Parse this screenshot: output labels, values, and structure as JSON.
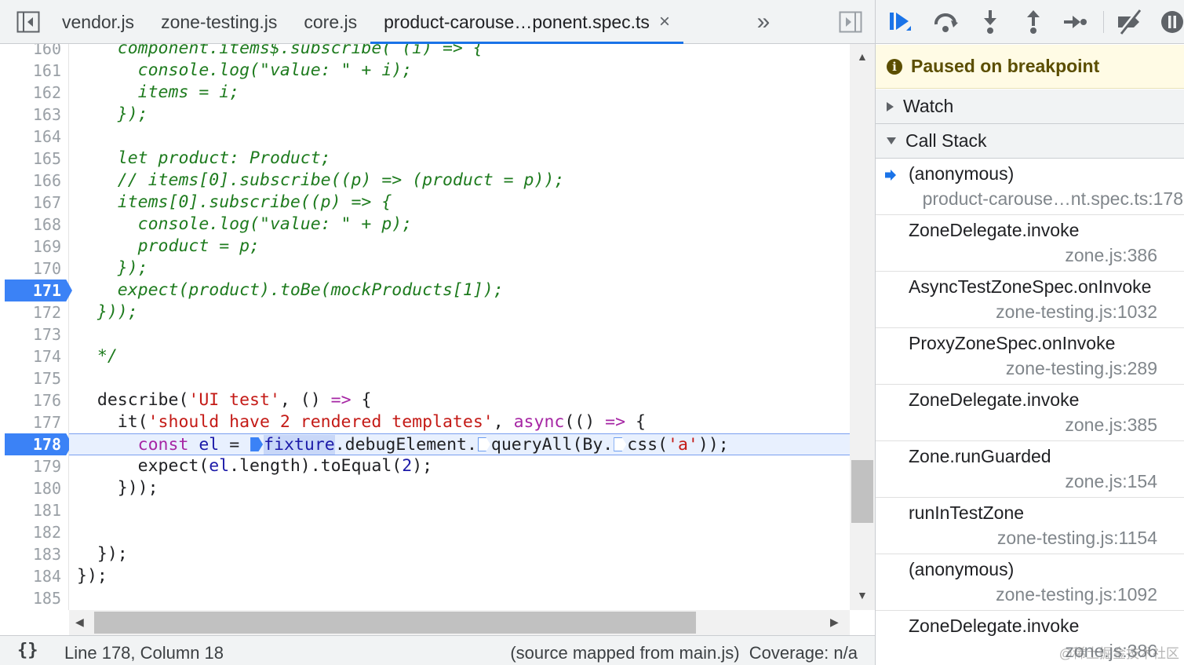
{
  "editor": {
    "tabs": [
      {
        "label": "vendor.js",
        "active": false
      },
      {
        "label": "zone-testing.js",
        "active": false
      },
      {
        "label": "core.js",
        "active": false
      },
      {
        "label": "product-carouse…ponent.spec.ts",
        "active": true
      }
    ],
    "tab_close_glyph": "×",
    "more_tabs_glyph": "»",
    "lines": [
      {
        "n": "160",
        "tokens": [
          {
            "t": "    component.items$.subscribe( (i) => {",
            "c": "cm"
          }
        ]
      },
      {
        "n": "161",
        "tokens": [
          {
            "t": "      console.log(\"value: \" + i);",
            "c": "cm"
          }
        ]
      },
      {
        "n": "162",
        "tokens": [
          {
            "t": "      items = i;",
            "c": "cm"
          }
        ]
      },
      {
        "n": "163",
        "tokens": [
          {
            "t": "    });",
            "c": "cm"
          }
        ]
      },
      {
        "n": "164",
        "tokens": []
      },
      {
        "n": "165",
        "tokens": [
          {
            "t": "    let product: Product;",
            "c": "cm"
          }
        ]
      },
      {
        "n": "166",
        "tokens": [
          {
            "t": "    // items[0].subscribe((p) => (product = p));",
            "c": "cm"
          }
        ]
      },
      {
        "n": "167",
        "tokens": [
          {
            "t": "    items[0].subscribe((p) => {",
            "c": "cm"
          }
        ]
      },
      {
        "n": "168",
        "tokens": [
          {
            "t": "      console.log(\"value: \" + p);",
            "c": "cm"
          }
        ]
      },
      {
        "n": "169",
        "tokens": [
          {
            "t": "      product = p;",
            "c": "cm"
          }
        ]
      },
      {
        "n": "170",
        "tokens": [
          {
            "t": "    });",
            "c": "cm"
          }
        ]
      },
      {
        "n": "171",
        "bp": true,
        "tokens": [
          {
            "t": "    expect(product).toBe(mockProducts[1]);",
            "c": "cm"
          }
        ]
      },
      {
        "n": "172",
        "tokens": [
          {
            "t": "  }));",
            "c": "cm"
          }
        ]
      },
      {
        "n": "173",
        "tokens": []
      },
      {
        "n": "174",
        "tokens": [
          {
            "t": "  */",
            "c": "cm"
          }
        ]
      },
      {
        "n": "175",
        "tokens": []
      },
      {
        "n": "176",
        "tokens": [
          {
            "t": "  describe(",
            "c": "fn"
          },
          {
            "t": "'UI test'",
            "c": "str"
          },
          {
            "t": ", () ",
            "c": "fn"
          },
          {
            "t": "=>",
            "c": "kw"
          },
          {
            "t": " {",
            "c": "fn"
          }
        ]
      },
      {
        "n": "177",
        "tokens": [
          {
            "t": "    it(",
            "c": "fn"
          },
          {
            "t": "'should have 2 rendered templates'",
            "c": "str"
          },
          {
            "t": ", ",
            "c": "fn"
          },
          {
            "t": "async",
            "c": "kw"
          },
          {
            "t": "(() ",
            "c": "fn"
          },
          {
            "t": "=>",
            "c": "kw"
          },
          {
            "t": " {",
            "c": "fn"
          }
        ]
      },
      {
        "n": "178",
        "bp": true,
        "hl": true,
        "tokens": [
          {
            "t": "      ",
            "c": "fn"
          },
          {
            "t": "const",
            "c": "kw"
          },
          {
            "t": " ",
            "c": "fn"
          },
          {
            "t": "el",
            "c": "var"
          },
          {
            "t": " = ",
            "c": "fn"
          },
          {
            "bpmark": "on"
          },
          {
            "t": "fixture",
            "c": "var",
            "sel": true
          },
          {
            "t": ".debugElement.",
            "c": "fn"
          },
          {
            "bpmark": "off"
          },
          {
            "t": "queryAll(By.",
            "c": "fn"
          },
          {
            "bpmark": "off"
          },
          {
            "t": "css(",
            "c": "fn"
          },
          {
            "t": "'a'",
            "c": "str"
          },
          {
            "t": "));",
            "c": "fn"
          }
        ]
      },
      {
        "n": "179",
        "tokens": [
          {
            "t": "      expect(",
            "c": "fn"
          },
          {
            "t": "el",
            "c": "var"
          },
          {
            "t": ".length).toEqual(",
            "c": "fn"
          },
          {
            "t": "2",
            "c": "num"
          },
          {
            "t": ");",
            "c": "fn"
          }
        ]
      },
      {
        "n": "180",
        "tokens": [
          {
            "t": "    }));",
            "c": "fn"
          }
        ]
      },
      {
        "n": "181",
        "tokens": []
      },
      {
        "n": "182",
        "tokens": []
      },
      {
        "n": "183",
        "tokens": [
          {
            "t": "  });",
            "c": "fn"
          }
        ]
      },
      {
        "n": "184",
        "tokens": [
          {
            "t": "});",
            "c": "fn"
          }
        ]
      },
      {
        "n": "185",
        "tokens": []
      }
    ],
    "status": {
      "braces": "{}",
      "cursor": "Line 178, Column 18",
      "source_info": "(source mapped from main.js)  Coverage: n/a"
    }
  },
  "debugger": {
    "paused_message": "Paused on breakpoint",
    "info_glyph": "i",
    "sections": {
      "watch": "Watch",
      "call_stack": "Call Stack"
    },
    "call_stack": [
      {
        "fn": "(anonymous)",
        "loc": "product-carouse…nt.spec.ts:178",
        "current": true
      },
      {
        "fn": "ZoneDelegate.invoke",
        "loc": "zone.js:386"
      },
      {
        "fn": "AsyncTestZoneSpec.onInvoke",
        "loc": "zone-testing.js:1032"
      },
      {
        "fn": "ProxyZoneSpec.onInvoke",
        "loc": "zone-testing.js:289"
      },
      {
        "fn": "ZoneDelegate.invoke",
        "loc": "zone.js:385"
      },
      {
        "fn": "Zone.runGuarded",
        "loc": "zone.js:154"
      },
      {
        "fn": "runInTestZone",
        "loc": "zone-testing.js:1154"
      },
      {
        "fn": "(anonymous)",
        "loc": "zone-testing.js:1092"
      },
      {
        "fn": "ZoneDelegate.invoke",
        "loc": "zone.js:386"
      }
    ],
    "watermark": "@稀土掘金技术社区"
  },
  "colors": {
    "accent": "#1a73e8",
    "breakpoint": "#3b82f6",
    "paused_bg": "#fffbe5",
    "comment_green": "#1e7b1e",
    "string_red": "#c41a16",
    "keyword_purple": "#a626a4"
  }
}
